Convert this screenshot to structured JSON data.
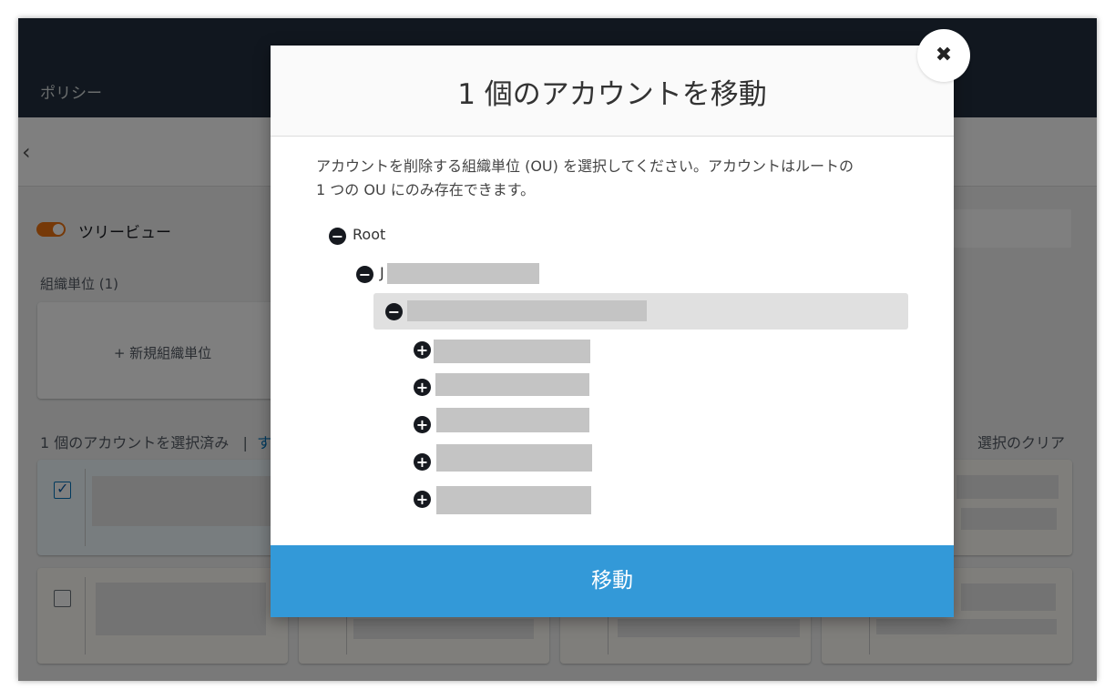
{
  "background": {
    "nav_tab": "ポリシー",
    "back_icon": "chevron-left-icon",
    "tree_view_label": "ツリービュー",
    "ou_section_title": "組織単位 (1)",
    "new_ou_label": "+ 新規組織単位",
    "selected_count": "1 個のアカウントを選択済み",
    "separator": "|",
    "link_fragment": "す",
    "clear_selection": "選択のクリア"
  },
  "modal": {
    "title": "1 個のアカウントを移動",
    "close_icon": "close-icon",
    "description_line1": "アカウントを削除する組織単位 (OU) を選択してください。アカウントはルートの",
    "description_line2": "1 つの OU にのみ存在できます。",
    "tree": {
      "root_label": "Root",
      "level1_label_prefix": "J",
      "collapse_icon": "minus-circle-icon",
      "expand_icon": "plus-circle-icon"
    },
    "move_button": "移動"
  },
  "colors": {
    "topbar": "#232f3e",
    "toggle": "#ec7211",
    "move_button": "#3399d8",
    "link": "#0073bb"
  }
}
